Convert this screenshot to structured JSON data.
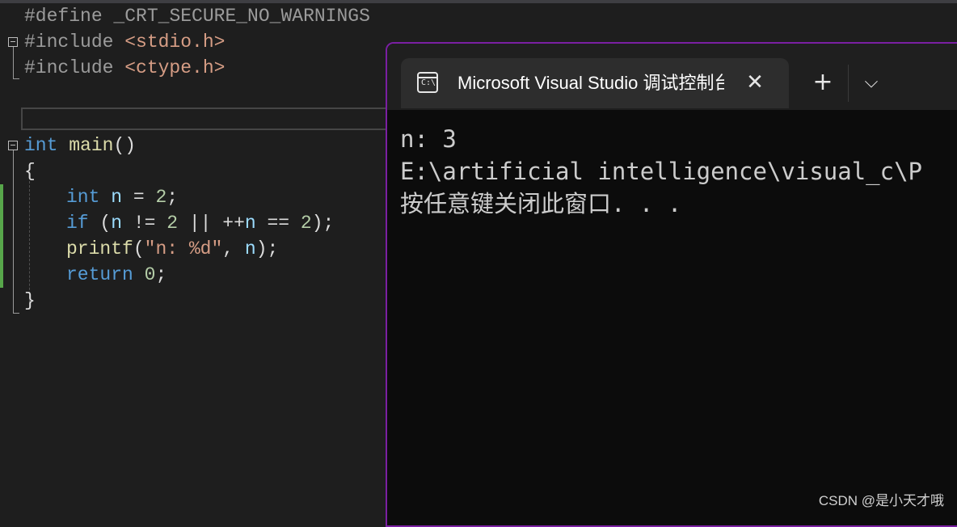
{
  "editor": {
    "lines": {
      "define_kw": "#define",
      "define_name": " _CRT_SECURE_NO_WARNINGS",
      "include1_kw": "#include",
      "include1_hdr": " <stdio.h>",
      "include2_kw": "#include",
      "include2_hdr": " <ctype.h>",
      "main_kw": "int",
      "main_fn": " main",
      "main_paren": "()",
      "open_brace": "{",
      "decl_kw": "int",
      "decl_rest_var": " n",
      "decl_rest_op": " = ",
      "decl_num": "2",
      "decl_semi": ";",
      "if_kw": "if",
      "if_p1": " (",
      "if_n1": "n",
      "if_op1": " != ",
      "if_num1": "2",
      "if_op2": " || ++",
      "if_n2": "n",
      "if_op3": " == ",
      "if_num2": "2",
      "if_end": ");",
      "printf_fn": "printf",
      "printf_p": "(",
      "printf_str": "\"n: %d\"",
      "printf_comma": ", ",
      "printf_var": "n",
      "printf_end": ");",
      "return_kw": "return",
      "return_sp": " ",
      "return_num": "0",
      "return_semi": ";",
      "close_brace": "}"
    }
  },
  "terminal": {
    "tab_title": "Microsoft Visual Studio 调试控制台",
    "tab_icon_text": "C:\\",
    "close_glyph": "✕",
    "new_tab_glyph": "+",
    "dropdown_glyph": "⌵",
    "output": [
      "n: 3",
      "E:\\artificial intelligence\\visual_c\\P",
      "按任意键关闭此窗口. . ."
    ]
  },
  "watermark": "CSDN @是小天才哦",
  "colors": {
    "editor_bg": "#1e1e1e",
    "keyword": "#569cd6",
    "function": "#dcdcaa",
    "string": "#d69d85",
    "number": "#b5cea8",
    "terminal_bg": "#0c0c0c",
    "terminal_border": "#7a1fa2",
    "change_bar": "#57a64a"
  }
}
